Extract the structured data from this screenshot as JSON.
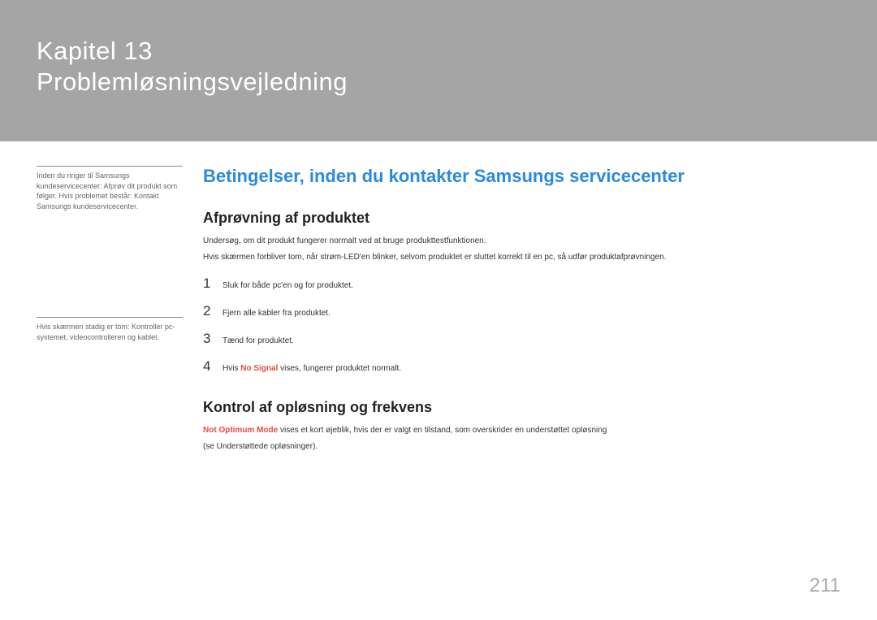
{
  "header": {
    "chapter_label": "Kapitel  13",
    "chapter_title": "Problemløsningsvejledning"
  },
  "sidebar": {
    "note1": "Inden du ringer til Samsungs kundeservicecenter: Afprøv dit produkt som følger. Hvis problemet består: Kontakt Samsungs kundeservicecenter.",
    "note2": "Hvis skærmen stadig er tom: Kontroller pc-systemet, videocontrolleren og kablet."
  },
  "main": {
    "section_title": "Betingelser, inden du kontakter Samsungs servicecenter",
    "sub1": {
      "title": "Afprøvning af produktet",
      "p1": "Undersøg, om dit produkt fungerer normalt ved at bruge produkttestfunktionen.",
      "p2": "Hvis skærmen forbliver tom, når strøm-LED'en blinker, selvom produktet er sluttet korrekt til en pc, så udfør produktafprøvningen.",
      "steps": [
        {
          "num": "1",
          "text": "Sluk for både pc'en og for produktet."
        },
        {
          "num": "2",
          "text": "Fjern alle kabler fra produktet."
        },
        {
          "num": "3",
          "text": "Tænd for produktet."
        },
        {
          "num": "4",
          "prefix": "Hvis ",
          "highlight": "No Signal",
          "suffix": " vises, fungerer produktet normalt."
        }
      ]
    },
    "sub2": {
      "title": "Kontrol af opløsning og frekvens",
      "p1_highlight": "Not Optimum Mode",
      "p1_rest": " vises et kort øjeblik, hvis der er valgt en tilstand, som overskrider en understøttet opløsning",
      "p2": "(se Understøttede opløsninger)."
    }
  },
  "page_number": "211"
}
